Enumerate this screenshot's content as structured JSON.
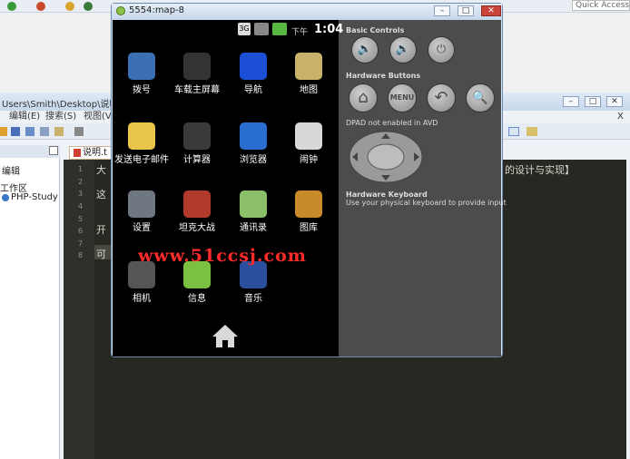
{
  "ide": {
    "quick_access": "Quick Access",
    "path": "Users\\Smith\\Desktop\\说明.t",
    "menu": [
      "编辑(E)",
      "搜索(S)",
      "视图(V"
    ],
    "window_controls": [
      "–",
      "□",
      "✕"
    ],
    "secondary_close": "X",
    "panel_header": "编辑",
    "tree": [
      "工作区",
      "PHP-Study"
    ],
    "editor_tab": "说明.t",
    "line_numbers": [
      "1",
      "2",
      "3",
      "4",
      "5",
      "6",
      "7",
      "8"
    ],
    "code_lines": [
      {
        "line": 1,
        "text": "大"
      },
      {
        "line": 3,
        "text": "这"
      },
      {
        "line": 6,
        "text": "开"
      },
      {
        "line": 8,
        "text": "可"
      }
    ],
    "code_right_fragment": "的设计与实现】"
  },
  "emulator": {
    "title": "5554:map-8",
    "status": {
      "network": "3G",
      "clock_prefix": "下午",
      "clock": "1:04"
    },
    "apps": [
      {
        "label": "拨号",
        "icon": "phone-icon",
        "color": "#3b6fb3"
      },
      {
        "label": "车载主屏幕",
        "icon": "car-home-icon",
        "color": "#333333"
      },
      {
        "label": "导航",
        "icon": "navigation-icon",
        "color": "#1d4fd6"
      },
      {
        "label": "地图",
        "icon": "maps-icon",
        "color": "#c9b26a"
      },
      {
        "label": "发送电子邮件",
        "icon": "email-icon",
        "color": "#e9c44a"
      },
      {
        "label": "计算器",
        "icon": "calculator-icon",
        "color": "#3a3a3a"
      },
      {
        "label": "浏览器",
        "icon": "browser-icon",
        "color": "#2a6fd0"
      },
      {
        "label": "闹钟",
        "icon": "alarm-icon",
        "color": "#d8d8d8"
      },
      {
        "label": "设置",
        "icon": "settings-icon",
        "color": "#6f7780"
      },
      {
        "label": "坦克大战",
        "icon": "tank-icon",
        "color": "#b13a2e"
      },
      {
        "label": "通讯录",
        "icon": "contacts-icon",
        "color": "#8bbf6a"
      },
      {
        "label": "图库",
        "icon": "gallery-icon",
        "color": "#c98a2a"
      },
      {
        "label": "相机",
        "icon": "camera-icon",
        "color": "#555555"
      },
      {
        "label": "信息",
        "icon": "messaging-icon",
        "color": "#7bc043"
      },
      {
        "label": "音乐",
        "icon": "music-icon",
        "color": "#2b4f9e"
      }
    ],
    "watermark": "www.51ccsj.com",
    "basic_controls_title": "Basic Controls",
    "basic_controls": [
      {
        "name": "volume-down-button",
        "glyph": "🔈"
      },
      {
        "name": "volume-up-button",
        "glyph": "🔊"
      },
      {
        "name": "power-button",
        "glyph": "⏻"
      }
    ],
    "hardware_buttons_title": "Hardware Buttons",
    "hardware_buttons": [
      {
        "name": "home-hw-button",
        "glyph": "⌂"
      },
      {
        "name": "menu-hw-button",
        "glyph": "MENU"
      },
      {
        "name": "back-hw-button",
        "glyph": "↶"
      },
      {
        "name": "search-hw-button",
        "glyph": "🔍"
      }
    ],
    "dpad_note": "DPAD not enabled in AVD",
    "keyboard_title": "Hardware Keyboard",
    "keyboard_note": "Use your physical keyboard to provide input",
    "window_controls": [
      "–",
      "□",
      "✕"
    ]
  }
}
